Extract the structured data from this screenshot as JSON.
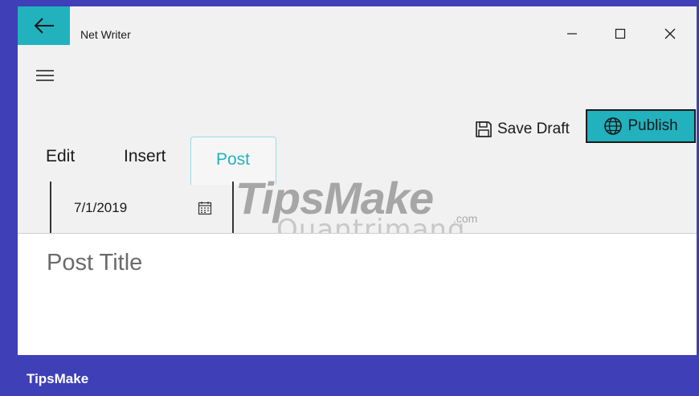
{
  "titlebar": {
    "app_title": "Net Writer"
  },
  "actions": {
    "save_draft_label": "Save Draft",
    "publish_label": "Publish"
  },
  "tabs": [
    {
      "label": "Edit",
      "active": false
    },
    {
      "label": "Insert",
      "active": false
    },
    {
      "label": "Post",
      "active": true
    }
  ],
  "post": {
    "date_value": "7/1/2019",
    "title_placeholder": "Post Title"
  },
  "watermark": {
    "logo": "TipsMake",
    "sub": "Quantrimang",
    "com": ".com"
  },
  "footer": {
    "brand": "TipsMake"
  },
  "icons": {
    "back": "back-arrow-icon",
    "menu": "hamburger-icon",
    "save": "floppy-disk-icon",
    "publish": "globe-icon",
    "calendar": "calendar-icon"
  },
  "colors": {
    "accent": "#21b2be",
    "outer_background": "#3f3fb8",
    "window_background": "#f1f1f1",
    "content_background": "#ffffff"
  }
}
